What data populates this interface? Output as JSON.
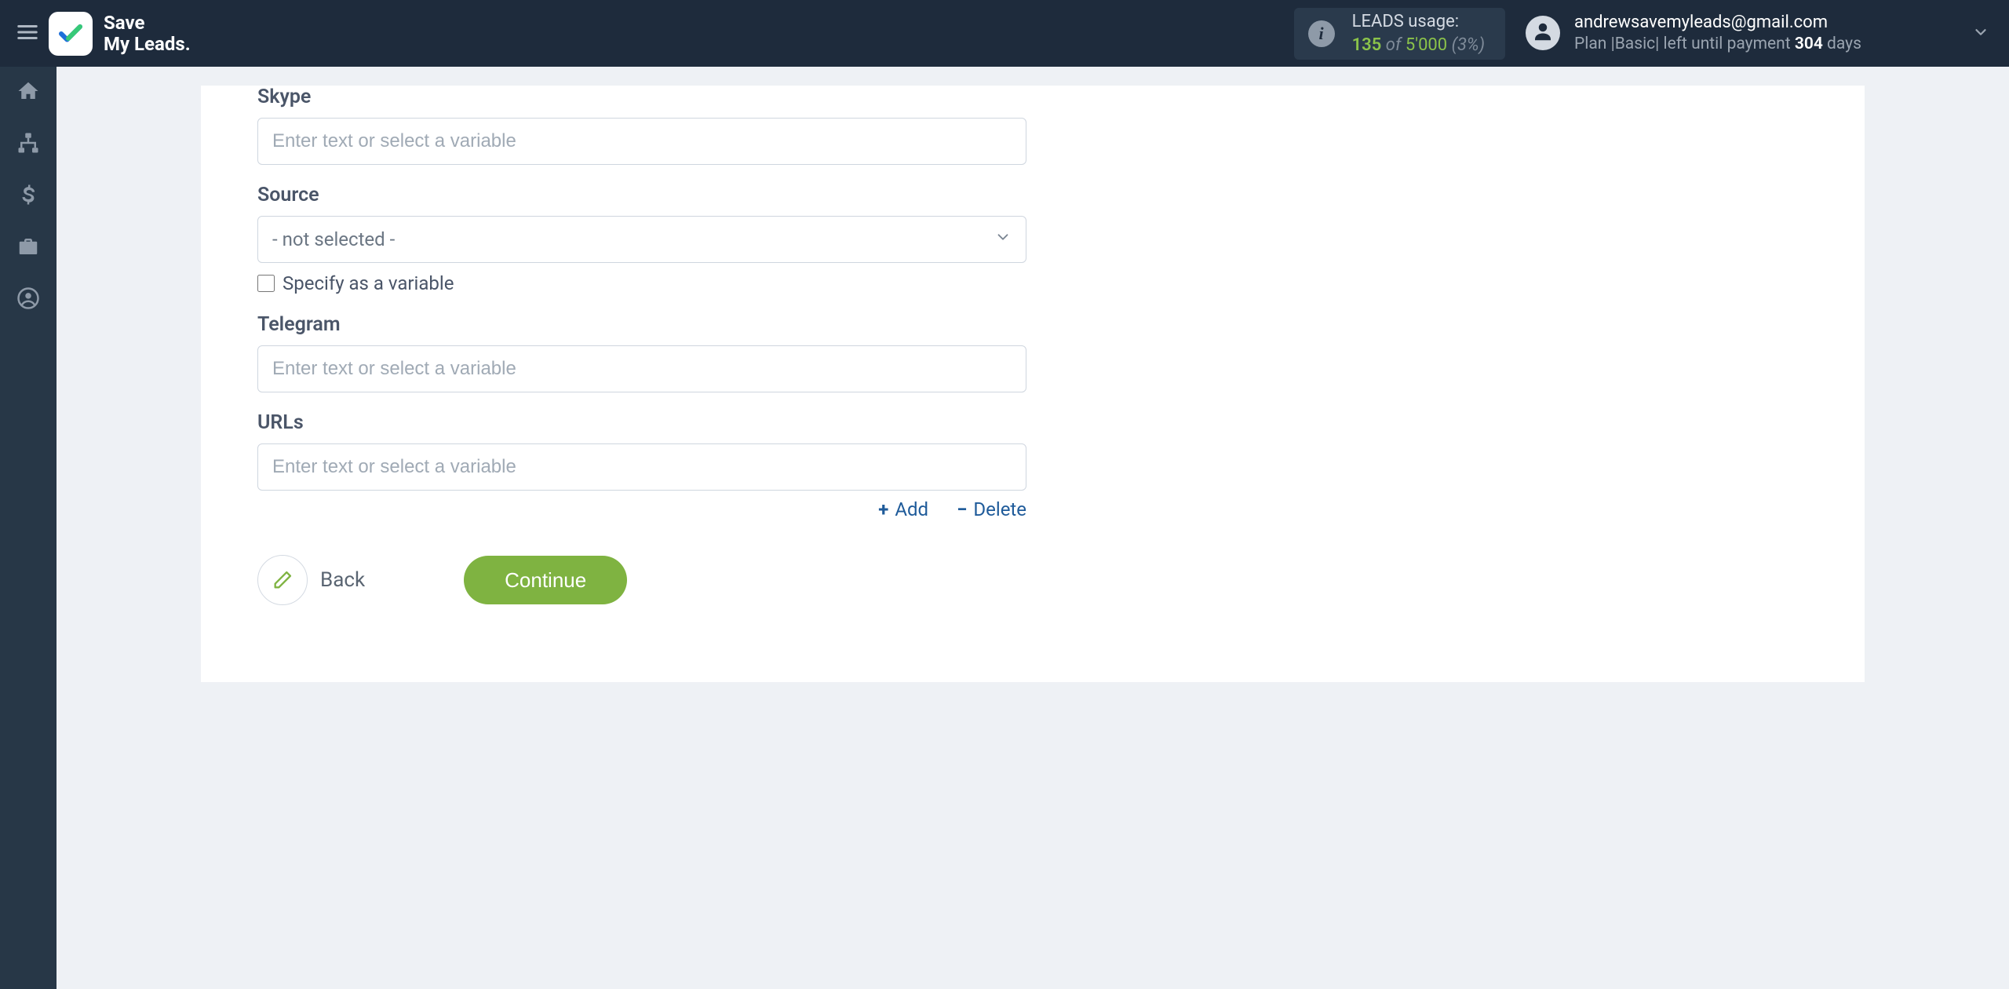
{
  "brand": {
    "line1": "Save",
    "line2": "My Leads."
  },
  "usage": {
    "label": "LEADS usage:",
    "used": "135",
    "of": "of",
    "limit": "5'000",
    "pct": "(3%)"
  },
  "account": {
    "email": "andrewsavemyleads@gmail.com",
    "plan_prefix": "Plan |",
    "plan_name": "Basic",
    "plan_mid": "| left until payment ",
    "days_num": "304",
    "days_suffix": " days"
  },
  "sidebar": {
    "items": [
      {
        "name": "home"
      },
      {
        "name": "connections"
      },
      {
        "name": "billing"
      },
      {
        "name": "briefcase"
      },
      {
        "name": "profile"
      }
    ]
  },
  "form": {
    "skype": {
      "label": "Skype",
      "placeholder": "Enter text or select a variable"
    },
    "source": {
      "label": "Source",
      "selected": "- not selected -",
      "specify_label": "Specify as a variable"
    },
    "telegram": {
      "label": "Telegram",
      "placeholder": "Enter text or select a variable"
    },
    "urls": {
      "label": "URLs",
      "placeholder": "Enter text or select a variable",
      "add": "Add",
      "delete": "Delete"
    }
  },
  "buttons": {
    "back": "Back",
    "continue": "Continue"
  }
}
